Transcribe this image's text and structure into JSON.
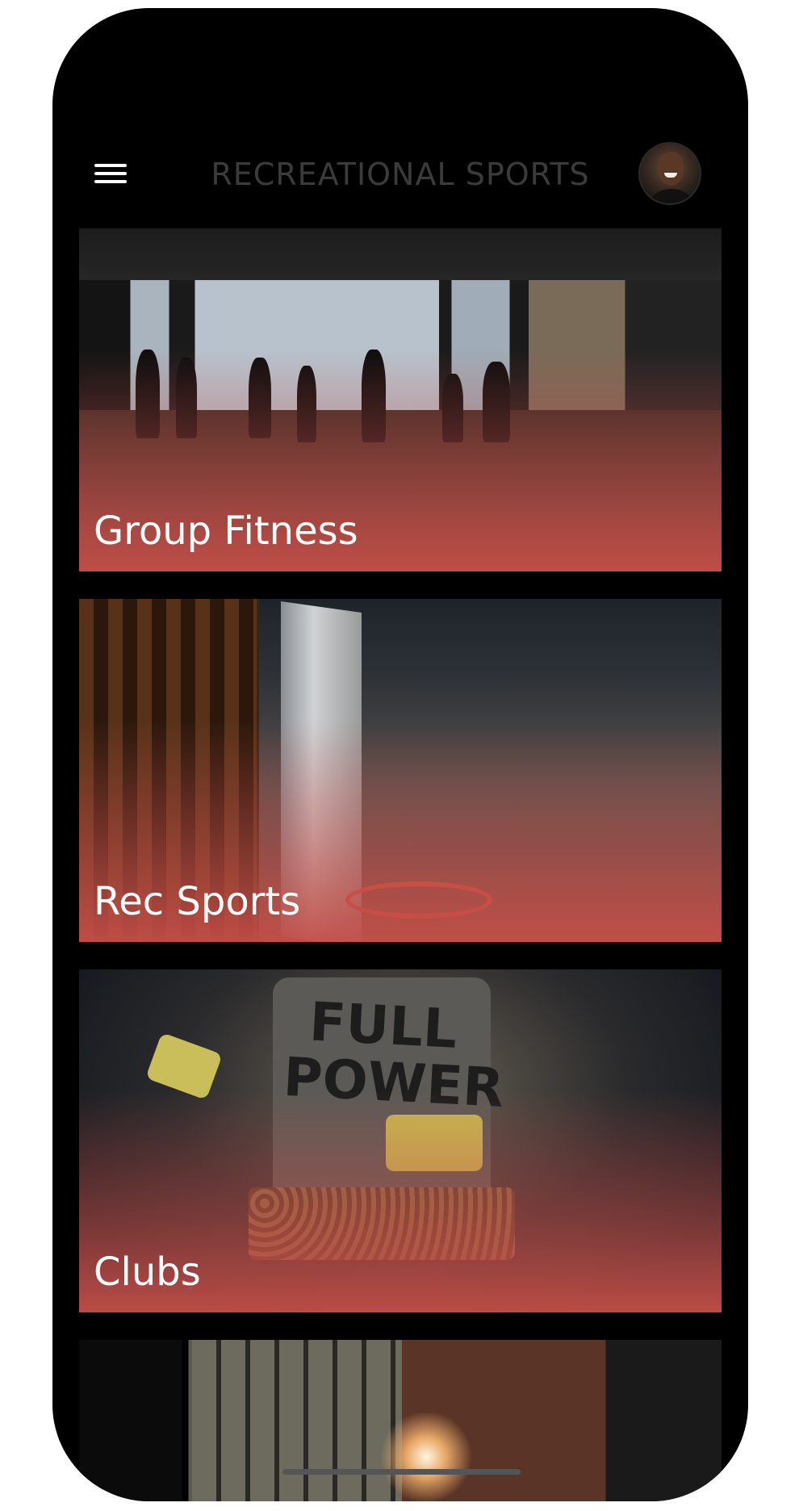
{
  "header": {
    "title": "RECREATIONAL SPORTS",
    "menu_icon": "hamburger-menu-icon",
    "avatar_icon": "user-avatar"
  },
  "cards": [
    {
      "label": "Group Fitness"
    },
    {
      "label": "Rec Sports"
    },
    {
      "label": "Clubs"
    },
    {
      "label": ""
    }
  ],
  "decor": {
    "shirt_text": "FULL POWER"
  },
  "colors": {
    "background": "#000000",
    "card_gradient": "#c44e48",
    "title_text": "#3b3b3b",
    "label_text": "#ffffff"
  }
}
